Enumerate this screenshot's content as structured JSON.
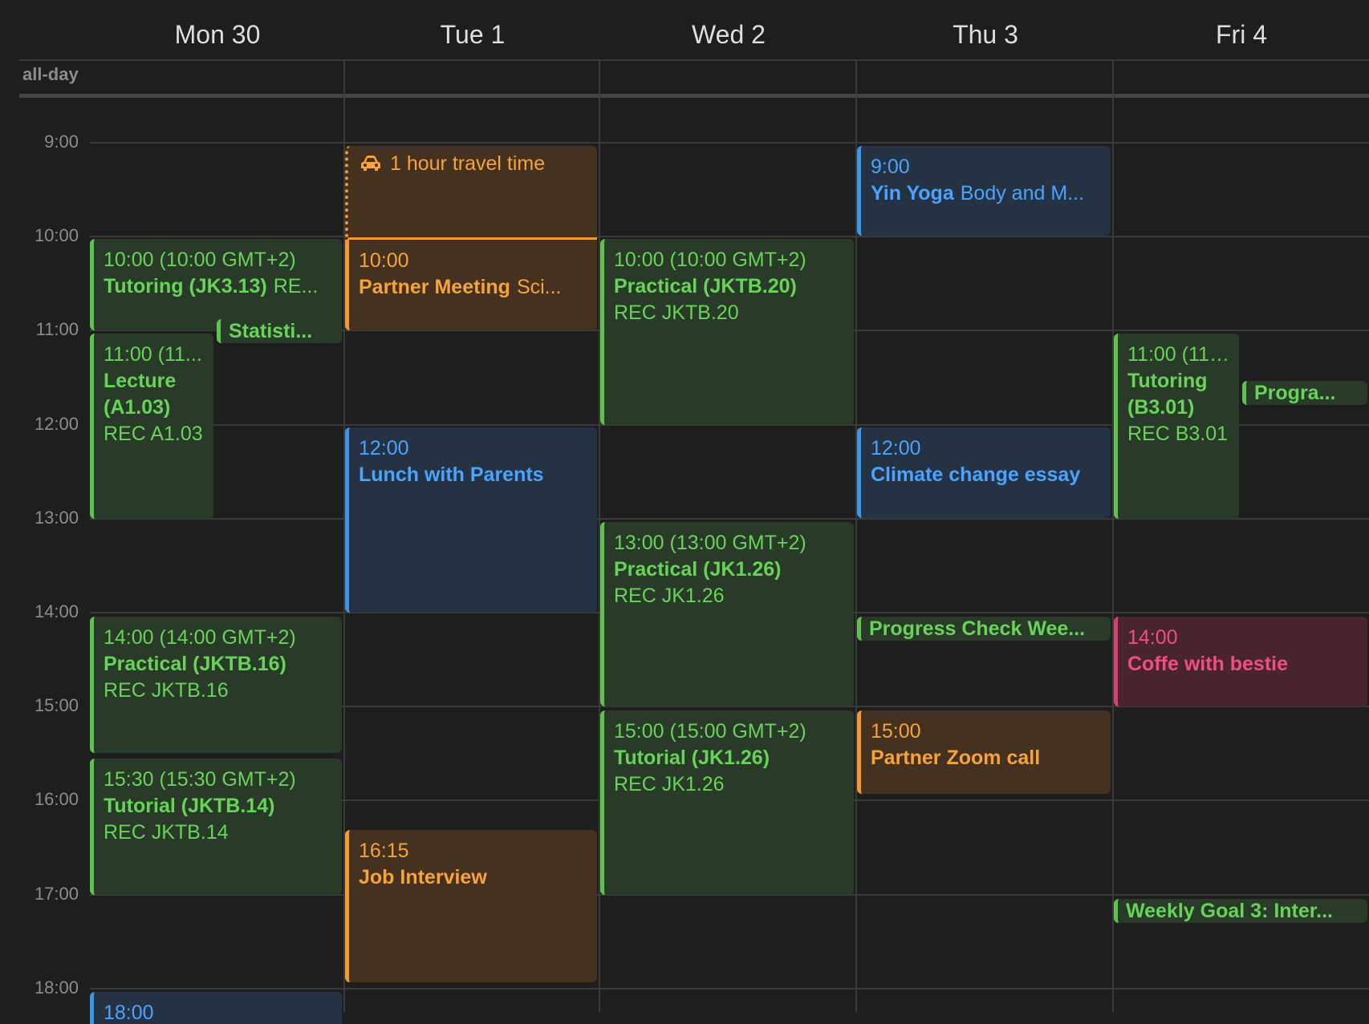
{
  "days": [
    "Mon 30",
    "Tue 1",
    "Wed 2",
    "Thu 3",
    "Fri 4"
  ],
  "allday_label": "all-day",
  "hours": [
    "9:00",
    "10:00",
    "11:00",
    "12:00",
    "13:00",
    "14:00",
    "15:00",
    "16:00",
    "17:00",
    "18:00"
  ],
  "colors": {
    "green": "#5ec24e",
    "blue": "#3d95e8",
    "orange": "#f39a2e",
    "pink": "#d93f6e"
  },
  "events": {
    "mon_tutoring": {
      "time": "10:00 (10:00 GMT+2)",
      "title": "Tutoring (JK3.13)",
      "location": "RE..."
    },
    "mon_statistics": {
      "title": "Statisti..."
    },
    "mon_lecture": {
      "time": "11:00 (11...",
      "title": "Lecture (A1.03)",
      "location": "REC A1.03"
    },
    "mon_practical": {
      "time": "14:00 (14:00 GMT+2)",
      "title": "Practical (JKTB.16)",
      "location": "REC JKTB.16"
    },
    "mon_tutorial": {
      "time": "15:30 (15:30 GMT+2)",
      "title": "Tutorial (JKTB.14)",
      "location": "REC JKTB.14"
    },
    "mon_18": {
      "time": "18:00"
    },
    "tue_travel": {
      "label": "1 hour travel time",
      "icon": "car-icon"
    },
    "tue_partner": {
      "time": "10:00",
      "title": "Partner Meeting",
      "sub": "Sci..."
    },
    "tue_lunch": {
      "time": "12:00",
      "title": "Lunch with Parents"
    },
    "tue_job": {
      "time": "16:15",
      "title": "Job Interview"
    },
    "wed_practical1": {
      "time": "10:00 (10:00 GMT+2)",
      "title": "Practical (JKTB.20)",
      "location": "REC JKTB.20"
    },
    "wed_practical2": {
      "time": "13:00 (13:00 GMT+2)",
      "title": "Practical (JK1.26)",
      "location": "REC JK1.26"
    },
    "wed_tutorial": {
      "time": "15:00 (15:00 GMT+2)",
      "title": "Tutorial (JK1.26)",
      "location": "REC JK1.26"
    },
    "thu_yoga": {
      "time": "9:00",
      "title": "Yin Yoga",
      "sub": "Body and M..."
    },
    "thu_climate": {
      "time": "12:00",
      "title": "Climate change essay"
    },
    "thu_progress": {
      "title": "Progress Check Wee..."
    },
    "thu_zoom": {
      "time": "15:00",
      "title": "Partner Zoom call"
    },
    "fri_tutoring": {
      "time": "11:00 (11:...",
      "title": "Tutoring (B3.01)",
      "location": "REC B3.01"
    },
    "fri_progra": {
      "title": "Progra..."
    },
    "fri_coffee": {
      "time": "14:00",
      "title": "Coffe with bestie"
    },
    "fri_goal": {
      "title": "Weekly Goal 3: Inter..."
    }
  }
}
